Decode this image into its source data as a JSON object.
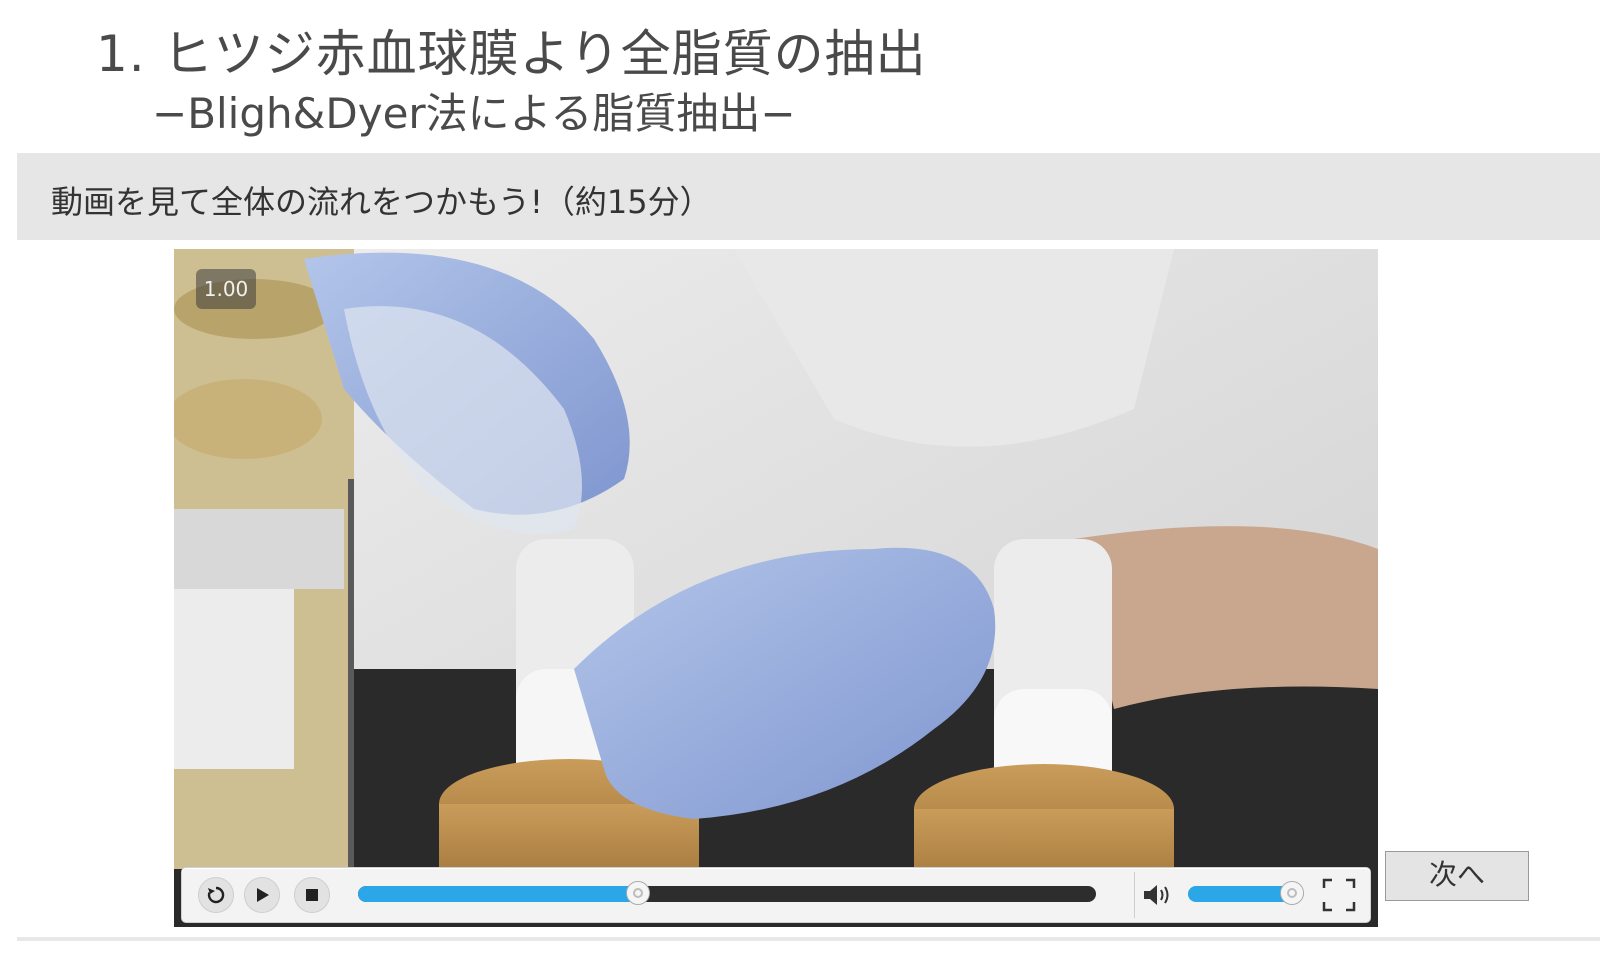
{
  "page": {
    "title": "1. ヒツジ赤血球膜より全脂質の抽出",
    "subtitle": "−Bligh&Dyer法による脂質抽出−",
    "banner_text": "動画を見て全体の流れをつかもう!（約15分）"
  },
  "video": {
    "playback_speed": "1.00",
    "progress": 0.38,
    "volume": 0.9,
    "icons": [
      "replay-icon",
      "play-icon",
      "stop-icon",
      "volume-icon",
      "fullscreen-icon"
    ]
  },
  "navigation": {
    "next_label": "次へ"
  },
  "colors": {
    "accent": "#2ba6e6",
    "banner_bg": "#e6e6e6",
    "track_bg": "#2d2d2d"
  }
}
